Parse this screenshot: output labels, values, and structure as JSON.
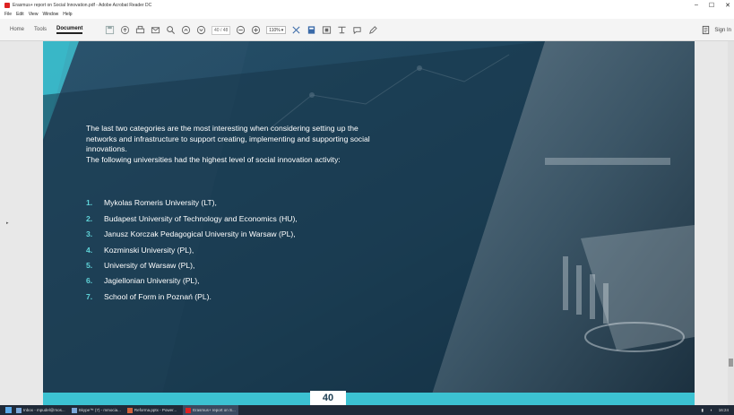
{
  "window": {
    "title": "Erasmus+ report on Social Innovation.pdf - Adobe Acrobat Reader DC",
    "controls": [
      "–",
      "☐",
      "✕"
    ]
  },
  "menu": [
    "File",
    "Edit",
    "View",
    "Window",
    "Help"
  ],
  "toolbar": {
    "tabs": [
      "Home",
      "Tools",
      "Document"
    ],
    "page_indicator": "40 / 48",
    "zoom": "110%",
    "sign_in": "Sign In"
  },
  "document": {
    "intro": [
      "The last two categories are the most interesting when considering setting up the",
      "networks and infrastructure to support creating, implementing and supporting social",
      "innovations.",
      "The following universities had the highest level of social innovation activity:"
    ],
    "universities": [
      {
        "num": "1.",
        "name": "Mykolas Romeris University (LT),"
      },
      {
        "num": "2.",
        "name": "Budapest University of Technology and Economics (HU),"
      },
      {
        "num": "3.",
        "name": "Janusz Korczak Pedagogical University in Warsaw (PL),"
      },
      {
        "num": "4.",
        "name": "Kozminski University (PL),"
      },
      {
        "num": "5.",
        "name": "University of Warsaw (PL),"
      },
      {
        "num": "6.",
        "name": "Jagiellonian University (PL),"
      },
      {
        "num": "7.",
        "name": "School of Form in Poznań (PL)."
      }
    ],
    "page_number": "40",
    "accent_color": "#3cc2d2"
  },
  "taskbar": {
    "items": [
      "Inbox - mpudel@mos...",
      "Skype™ (7) - mmocia...",
      "Reforma.pptx - Power...",
      "Erasmus+ report on S..."
    ],
    "clock": "16:24"
  }
}
